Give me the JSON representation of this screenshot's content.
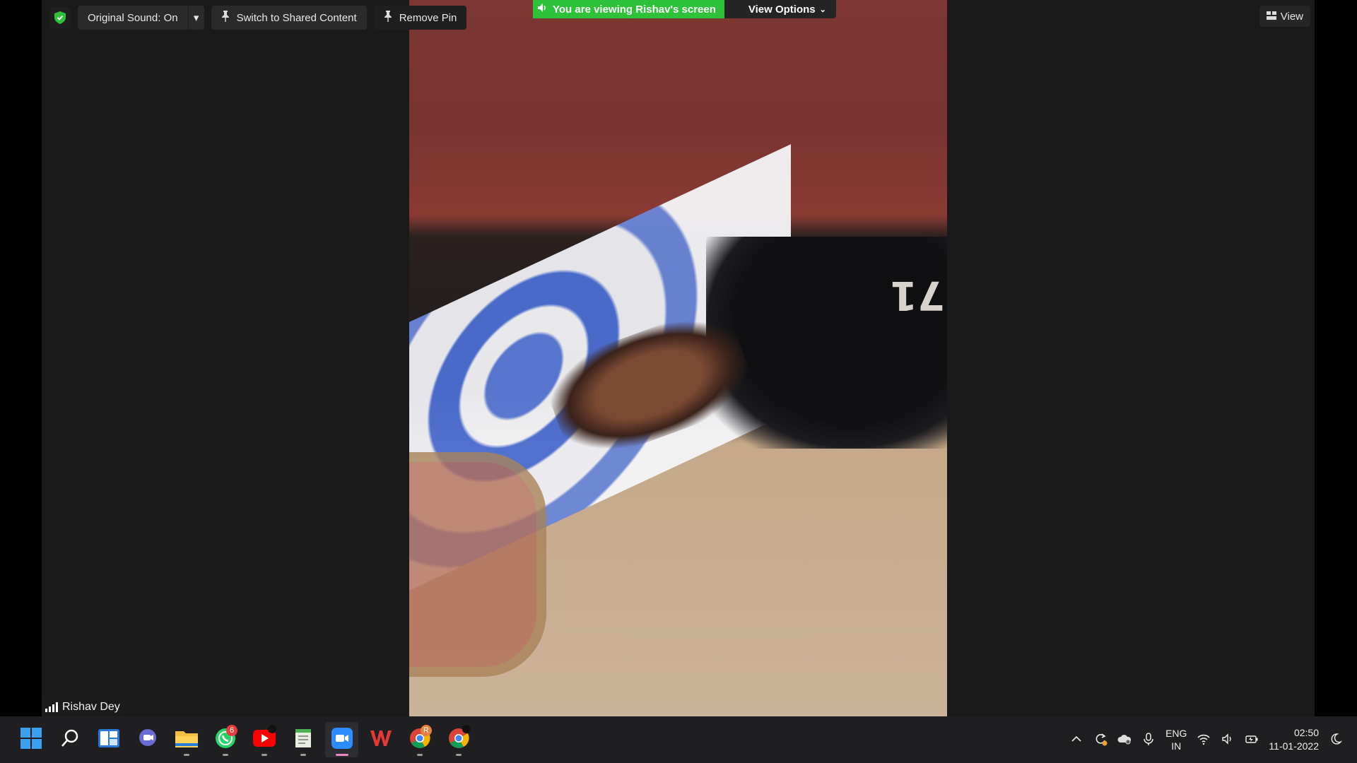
{
  "toolbar": {
    "original_sound_label": "Original Sound: On",
    "switch_shared_label": "Switch to Shared Content",
    "remove_pin_label": "Remove Pin"
  },
  "share_banner": {
    "text": "You are viewing Rishav's screen",
    "view_options_label": "View Options"
  },
  "view_button_label": "View",
  "participant": {
    "name": "Rishav Dey"
  },
  "video": {
    "shirt_number": "71"
  },
  "taskbar": {
    "apps": [
      {
        "name": "start",
        "badge": ""
      },
      {
        "name": "search",
        "badge": ""
      },
      {
        "name": "widgets",
        "badge": ""
      },
      {
        "name": "teams-chat",
        "badge": ""
      },
      {
        "name": "file-explorer",
        "badge": ""
      },
      {
        "name": "whatsapp",
        "badge": "6"
      },
      {
        "name": "youtube",
        "badge": ""
      },
      {
        "name": "notepad",
        "badge": ""
      },
      {
        "name": "zoom",
        "badge": ""
      },
      {
        "name": "wps-office",
        "badge": ""
      },
      {
        "name": "chrome-profile",
        "badge": "R"
      },
      {
        "name": "chrome",
        "badge": ""
      }
    ],
    "lang_line1": "ENG",
    "lang_line2": "IN",
    "time": "02:50",
    "date": "11-01-2022"
  },
  "colors": {
    "share_green": "#2ec23b",
    "whatsapp_badge": "#e63d3d",
    "zoom_active_indicator": "#e889c3"
  }
}
